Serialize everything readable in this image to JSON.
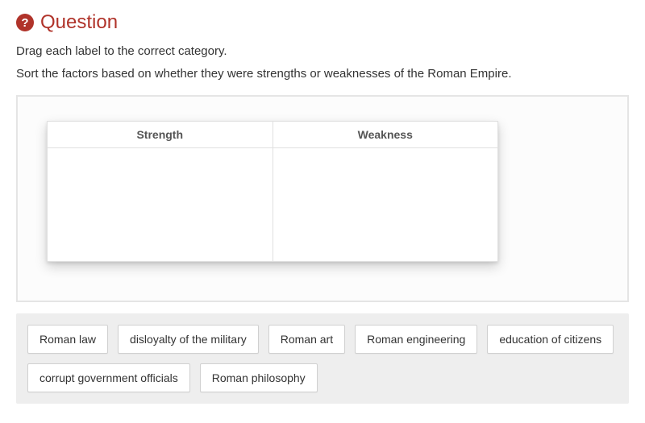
{
  "header": {
    "icon_text": "?",
    "title": "Question"
  },
  "instructions": "Drag each label to the correct category.",
  "prompt": "Sort the factors based on whether they were strengths or weaknesses of the Roman Empire.",
  "categories": {
    "col1": "Strength",
    "col2": "Weakness"
  },
  "labels": [
    "Roman law",
    "disloyalty of the military",
    "Roman art",
    "Roman engineering",
    "education of citizens",
    "corrupt government officials",
    "Roman philosophy"
  ]
}
